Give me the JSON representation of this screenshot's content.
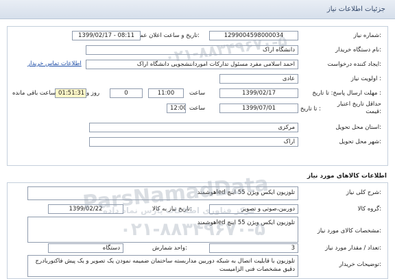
{
  "header": {
    "title": "جزئیات اطلاعات نیاز"
  },
  "need_info": {
    "need_number_label": "شماره نیاز:",
    "need_number": "1299004598000034",
    "announce_label": "تاریخ و ساعت اعلان عمومی:",
    "announce_value": "1399/02/17 - 08:11",
    "buyer_label": "نام دستگاه خریدار:",
    "buyer_value": "دانشگاه اراک",
    "creator_label": "ایجاد کننده درخواست:",
    "creator_value": "احمد  اسلامی مفرد مسئول تداركات امورداننشجویی دانشگاه اراک",
    "contact_link": "اطلاعات تماس خریدار",
    "priority_label": "اولویت نیاز :",
    "priority_value": "عادی",
    "deadline_label": "مهلت ارسال پاسخ: تا تاریخ :",
    "deadline_date": "1399/02/17",
    "time_word": "ساعت",
    "deadline_time": "11:00",
    "days_value": "0",
    "days_word": "روز و",
    "remaining_time": "01:51:31",
    "remaining_label": "ساعت باقی مانده",
    "validity_label_1": "حداقل تاریخ اعتبار",
    "validity_label_2": "قیمت:",
    "validity_until": "تا تاریخ :",
    "validity_date": "1399/07/01",
    "validity_time": "12:00",
    "province_label": "استان محل تحویل:",
    "province_value": "مرکزی",
    "city_label": "شهر محل تحویل:",
    "city_value": "اراک"
  },
  "goods": {
    "section_title": "اطلاعات کالاهای مورد نیاز",
    "summary_label": "شرح کلی نیاز:",
    "summary_value": "تلوزیون ایکس ویژن 55 اینچ ledهوشمند",
    "group_label": "گروه کالا:",
    "group_value": "دوربین،صوتی و تصویر",
    "need_date_label": "تاریخ نیاز به کالا:",
    "need_date_value": "1399/02/22",
    "spec_label": "مشخصات کالای مورد نیاز:",
    "spec_value": "تلوزیون ایکس ویژن 55 اینچ ledهوشمند",
    "qty_label": "تعداد / مقدار مورد نیاز:",
    "qty_value": "3",
    "unit_label": "واحد شمارش:",
    "unit_value": "دستگاه",
    "notes_label": "توضیحات خریدار:",
    "notes_value": "تلوزیون با قابلیت اتصال به شبکه دوربین مداربسته ساختمان ضمیمه نمودن یک تصویر و یک پیش فاکتوربادرج دقیق مشخصات فنی الزامیست"
  },
  "watermark": {
    "brand": "ParsNamadData",
    "brand_fa": "مرکز فناوری اطلاعات پارس نماد داده",
    "phone": "۰۲۱-۸۸۳۴۹۶۷۰-۵"
  }
}
